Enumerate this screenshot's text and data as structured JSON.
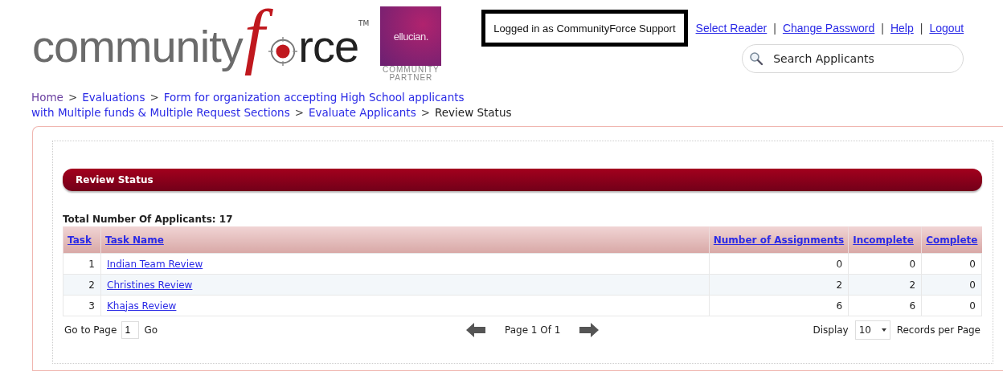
{
  "logo": {
    "lead": "community",
    "mark": "f",
    "tail": "rce",
    "tm": "TM"
  },
  "partner_badge": {
    "brand": "ellucian.",
    "line_1": "COMMUNITY",
    "line_2": "PARTNER"
  },
  "login_notice": "Logged in as CommunityForce Support",
  "top_links": [
    {
      "label": "Select Reader",
      "separator_after": "|"
    },
    {
      "label": "Change Password",
      "separator_after": "|"
    },
    {
      "label": "Help",
      "separator_after": "|"
    },
    {
      "label": "Logout"
    }
  ],
  "search": {
    "placeholder": "Search Applicants"
  },
  "breadcrumb": [
    [
      {
        "label": "Home",
        "kind": "visited",
        "separator_after": ">"
      },
      {
        "label": "Evaluations",
        "kind": "link",
        "separator_after": ">"
      },
      {
        "label": "Form for organization accepting High School applicants",
        "kind": "link"
      }
    ],
    [
      {
        "label": "with Multiple funds & Multiple Request Sections",
        "kind": "link",
        "separator_after": ">"
      },
      {
        "label": "Evaluate Applicants",
        "kind": "link",
        "separator_after": ">"
      },
      {
        "label": "Review Status",
        "kind": "current"
      }
    ]
  ],
  "section_title": "Review Status",
  "total_applicants": "Total Number Of Applicants: 17",
  "table": {
    "columns": [
      "Task",
      "Task Name",
      "Number of Assignments",
      "Incomplete",
      "Complete"
    ],
    "rows": [
      [
        "1",
        "Indian Team Review",
        "0",
        "0",
        "0"
      ],
      [
        "2",
        "Christines Review",
        "2",
        "2",
        "0"
      ],
      [
        "3",
        "Khajas Review",
        "6",
        "6",
        "0"
      ]
    ]
  },
  "pager": {
    "goto_label": "Go to Page",
    "page_value": "1",
    "go_label": "Go",
    "page_info": "Page 1 Of 1",
    "display_label": "Display",
    "page_size": "10",
    "records_label": "Records per Page"
  }
}
